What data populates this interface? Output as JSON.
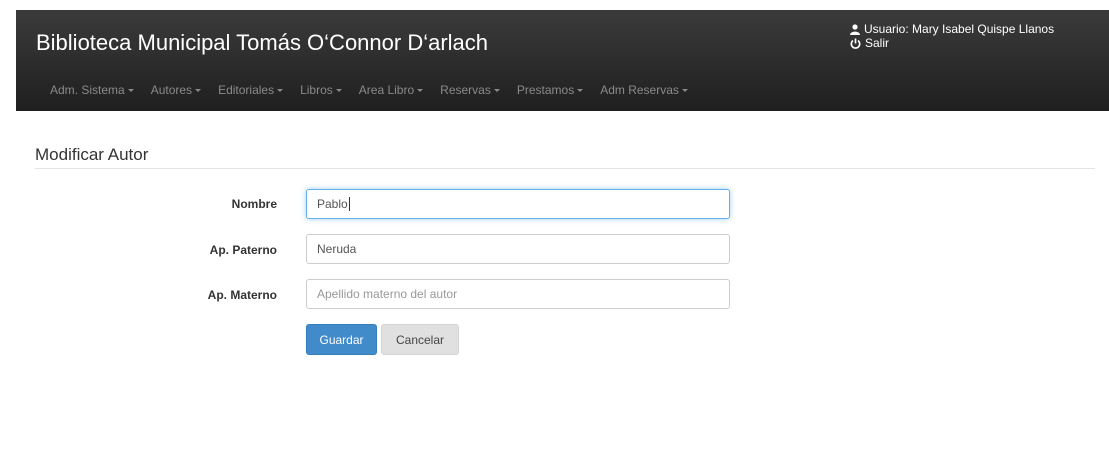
{
  "header": {
    "brand": "Biblioteca Municipal Tomás O‘Connor D‘arlach",
    "user_label": "Usuario: Mary Isabel Quispe Llanos",
    "logout_label": "Salir"
  },
  "menu": [
    {
      "label": "Adm. Sistema"
    },
    {
      "label": "Autores"
    },
    {
      "label": "Editoriales"
    },
    {
      "label": "Libros"
    },
    {
      "label": "Area Libro"
    },
    {
      "label": "Reservas"
    },
    {
      "label": "Prestamos"
    },
    {
      "label": "Adm Reservas"
    }
  ],
  "form": {
    "title": "Modificar Autor",
    "fields": [
      {
        "label": "Nombre",
        "value": "Pablo",
        "placeholder": ""
      },
      {
        "label": "Ap. Paterno",
        "value": "Neruda",
        "placeholder": ""
      },
      {
        "label": "Ap. Materno",
        "value": "",
        "placeholder": "Apellido materno del autor"
      }
    ],
    "save_label": "Guardar",
    "cancel_label": "Cancelar"
  },
  "colors": {
    "navbar": "#2b2b2b",
    "primary": "#428bca",
    "focus": "#66afe9"
  }
}
